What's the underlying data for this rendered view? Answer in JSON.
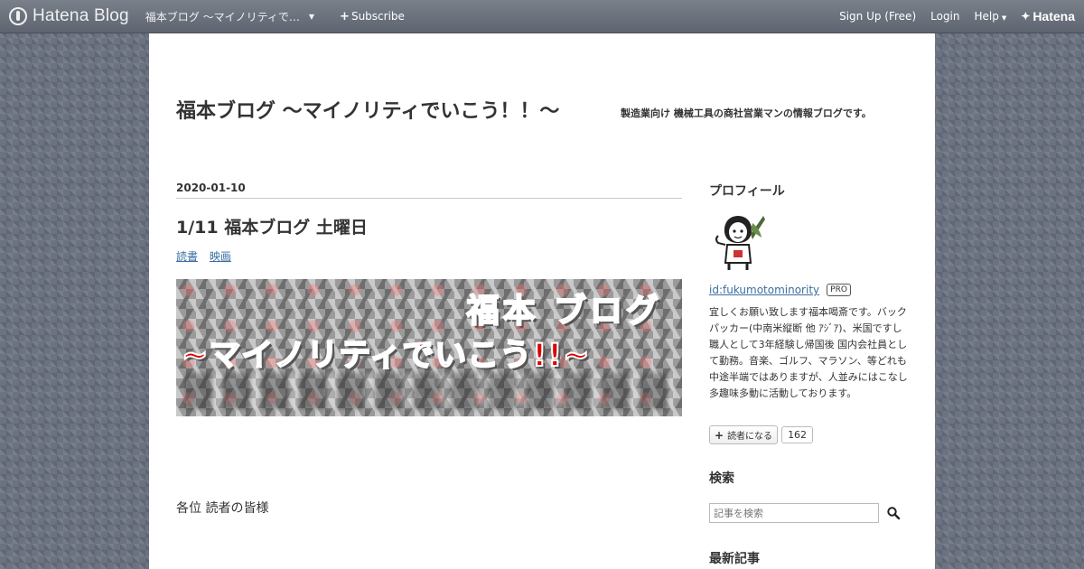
{
  "topbar": {
    "logo_text": "Hatena Blog",
    "blog_switcher": "福本ブログ ～マイノリティで…",
    "subscribe": "Subscribe",
    "signup": "Sign Up (Free)",
    "login": "Login",
    "help": "Help",
    "brand": "Hatena"
  },
  "header": {
    "title": "福本ブログ ～マイノリティでいこう！！～",
    "description": "製造業向け 機械工具の商社営業マンの情報ブログです。"
  },
  "entry": {
    "date": "2020-01-10",
    "title": "1/11 福本ブログ 土曜日",
    "categories": [
      "読書",
      "映画"
    ],
    "banner_line1": "福本 ブログ",
    "banner_line2": "~マイノリティでいこう!!~",
    "greeting": "各位 読者の皆様"
  },
  "sidebar": {
    "profile_heading": "プロフィール",
    "profile_id": "id:fukumotominority",
    "pro_badge": "PRO",
    "profile_text": "宜しくお願い致します福本喝斎です。バックパッカー(中南米縦断 他 ｱｼﾞｱ)、米国ですし職人として3年経験し帰国後 国内会社員として勤務。音楽、ゴルフ、マラソン、等どれも中途半端ではありますが、人並みにはこなし多趣味多動に活動しております。",
    "reader_button": "読者になる",
    "reader_count": "162",
    "search_heading": "検索",
    "search_placeholder": "記事を検索",
    "recent_heading": "最新記事"
  },
  "colors": {
    "link": "#3b6ea0",
    "banner_text": "#dd0000",
    "topbar": "#6b7280"
  }
}
